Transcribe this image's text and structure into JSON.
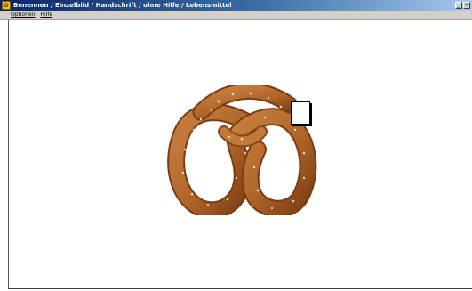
{
  "window": {
    "title": "Benennen / Einzelbild / Handschrift / ohne Hilfe / Lebensmittel",
    "app_icon_glyph": "✿",
    "controls": {
      "minimize": "_",
      "close": "×"
    }
  },
  "menu": {
    "items": [
      {
        "label": "Optionen"
      },
      {
        "label": "Hilfe"
      }
    ]
  },
  "stimulus": {
    "image": "pretzel-picture",
    "colors": {
      "dough": "#b0662a",
      "dough_dark": "#7a3d12",
      "salt": "#f2ece0"
    }
  }
}
